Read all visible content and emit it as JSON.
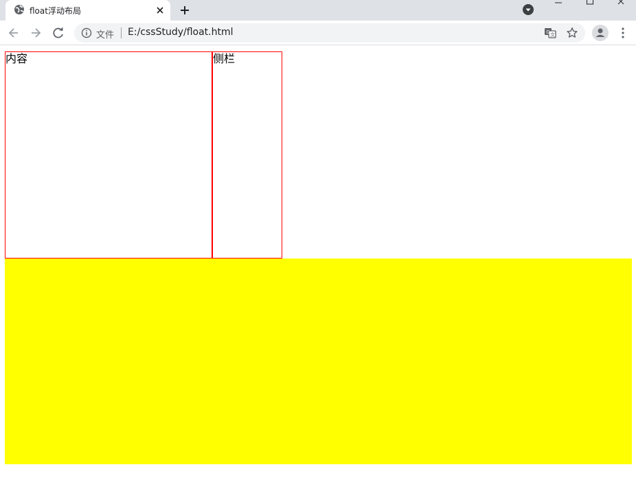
{
  "browser": {
    "tab": {
      "title": "float浮动布局",
      "favicon": "globe-icon"
    },
    "toolbar": {
      "scheme_label": "文件",
      "url": "E:/cssStudy/float.html"
    }
  },
  "page": {
    "content_box": {
      "text": "内容",
      "border_color": "#ff0000"
    },
    "sidebar_box": {
      "text": "侧栏",
      "border_color": "#ff0000"
    },
    "footer_block": {
      "background_color": "#ffff00"
    }
  }
}
